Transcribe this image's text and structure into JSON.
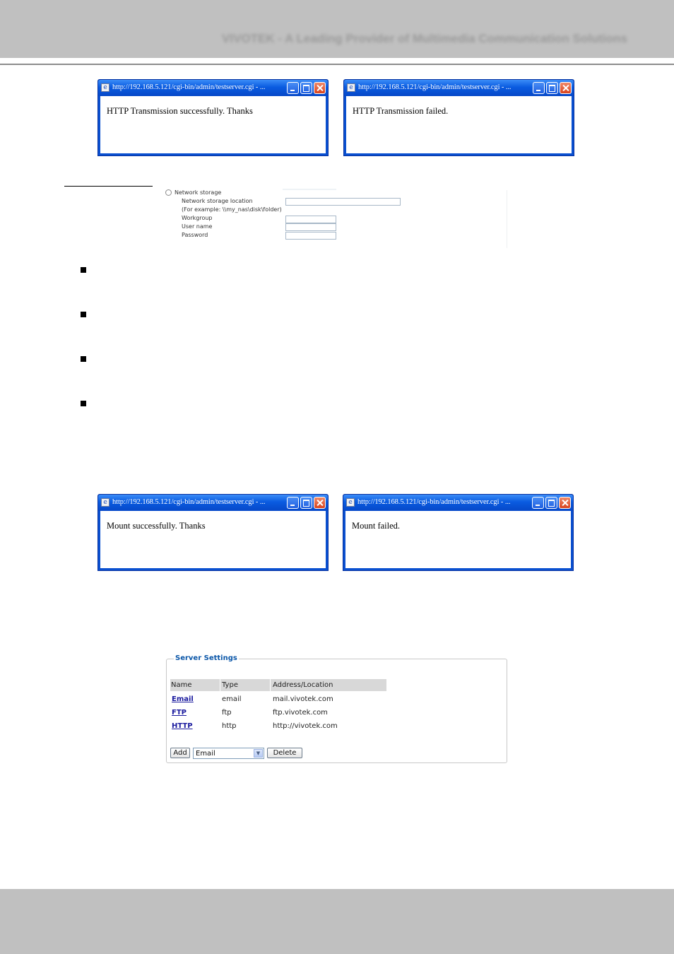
{
  "header": {
    "text": "VIVOTEK - A Leading Provider of Multimedia Communication Solutions"
  },
  "popups": [
    {
      "title": "http://192.168.5.121/cgi-bin/admin/testserver.cgi - ...",
      "message": "HTTP Transmission successfully. Thanks"
    },
    {
      "title": "http://192.168.5.121/cgi-bin/admin/testserver.cgi - ...",
      "message": "HTTP Transmission failed."
    },
    {
      "title": "http://192.168.5.121/cgi-bin/admin/testserver.cgi - ...",
      "message": "Mount successfully. Thanks"
    },
    {
      "title": "http://192.168.5.121/cgi-bin/admin/testserver.cgi - ...",
      "message": "Mount failed."
    }
  ],
  "network_storage": {
    "radio_label": "Network storage",
    "location_label": "Network storage location",
    "example_label": "(For example: \\\\my_nas\\disk\\folder)",
    "workgroup_label": "Workgroup",
    "username_label": "User name",
    "password_label": "Password",
    "location_value": "",
    "workgroup_value": "",
    "username_value": "",
    "password_value": ""
  },
  "server_settings": {
    "legend": "Server Settings",
    "columns": [
      "Name",
      "Type",
      "Address/Location"
    ],
    "rows": [
      {
        "name": "Email",
        "type": "email",
        "address": "mail.vivotek.com"
      },
      {
        "name": "FTP",
        "type": "ftp",
        "address": "ftp.vivotek.com"
      },
      {
        "name": "HTTP",
        "type": "http",
        "address": "http://vivotek.com"
      }
    ],
    "add_label": "Add",
    "select_value": "Email",
    "delete_label": "Delete"
  }
}
